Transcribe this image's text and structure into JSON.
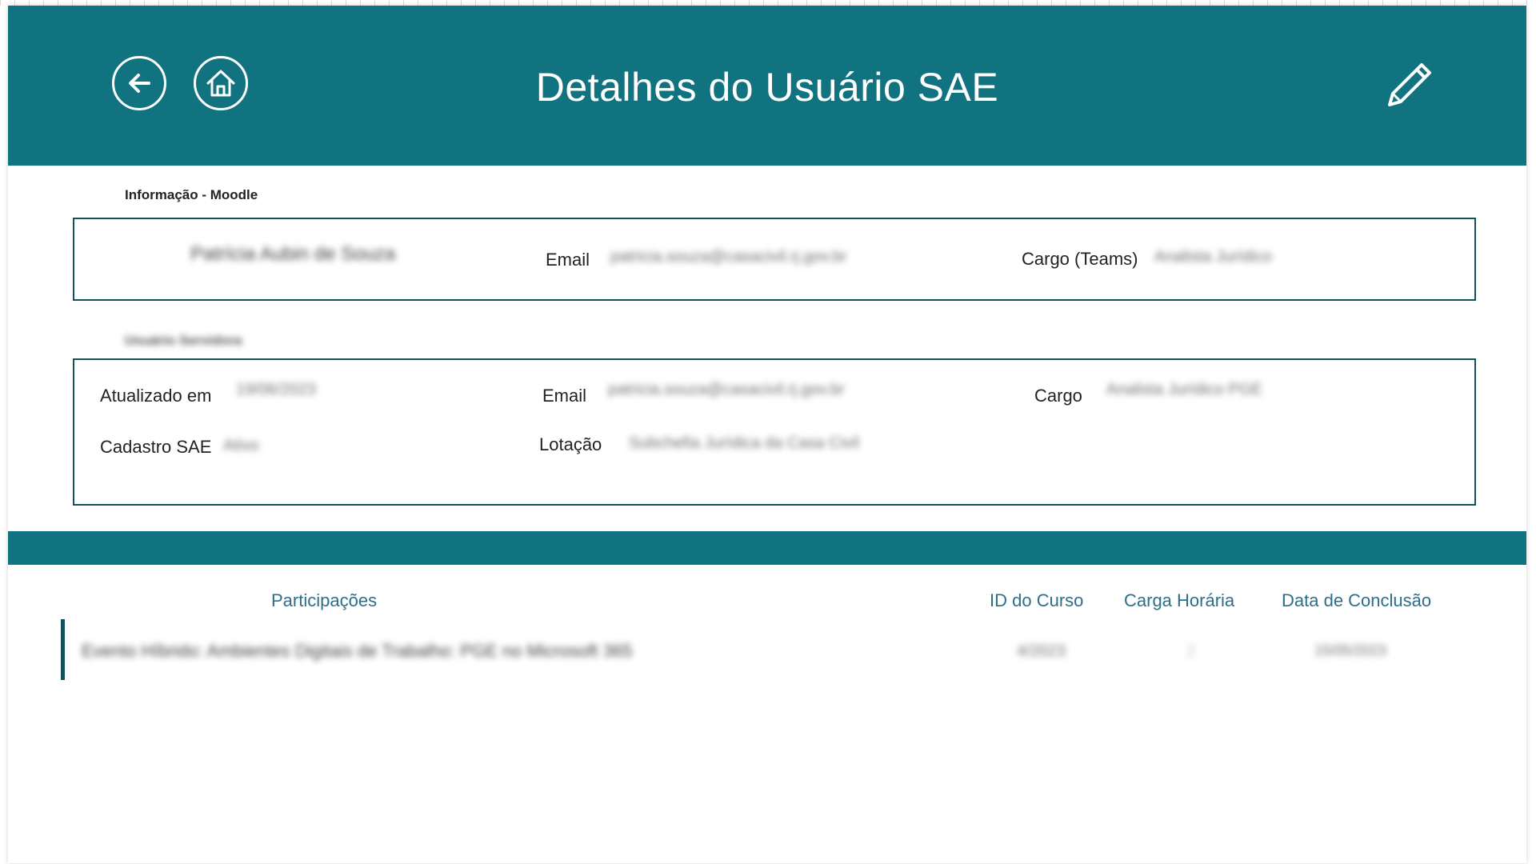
{
  "header": {
    "title": "Detalhes do Usuário SAE",
    "back_icon": "arrow-left-icon",
    "home_icon": "home-icon",
    "edit_icon": "pencil-icon",
    "background_color": "#117380"
  },
  "moodle_section": {
    "label": "Informação - Moodle",
    "name_value": "Patrícia Aubin de Souza",
    "email_label": "Email",
    "email_value": "patricia.souza@casacivil.rj.gov.br",
    "cargo_label": "Cargo (Teams)",
    "cargo_value": "Analista Jurídico"
  },
  "sae_section": {
    "label": "Usuário Servidora",
    "updated_label": "Atualizado em",
    "updated_value": "19/06/2023",
    "email_label": "Email",
    "email_value": "patricia.souza@casacivil.rj.gov.br",
    "cargo_label": "Cargo",
    "cargo_value": "Analista Jurídico PGE",
    "cadastro_label": "Cadastro SAE",
    "cadastro_value": "Ativo",
    "lotacao_label": "Lotação",
    "lotacao_value": "Subchefia Jurídica da Casa Civil"
  },
  "participations": {
    "columns": {
      "participacoes": "Participações",
      "id_curso": "ID do Curso",
      "carga_horaria": "Carga Horária",
      "data_conclusao": "Data de Conclusão"
    },
    "rows": [
      {
        "title": "Evento Híbrido: Ambientes Digitais de Trabalho: PGE no Microsoft 365",
        "id_curso": "4/2023",
        "carga_horaria": "2",
        "data_conclusao": "15/05/2023"
      }
    ]
  }
}
